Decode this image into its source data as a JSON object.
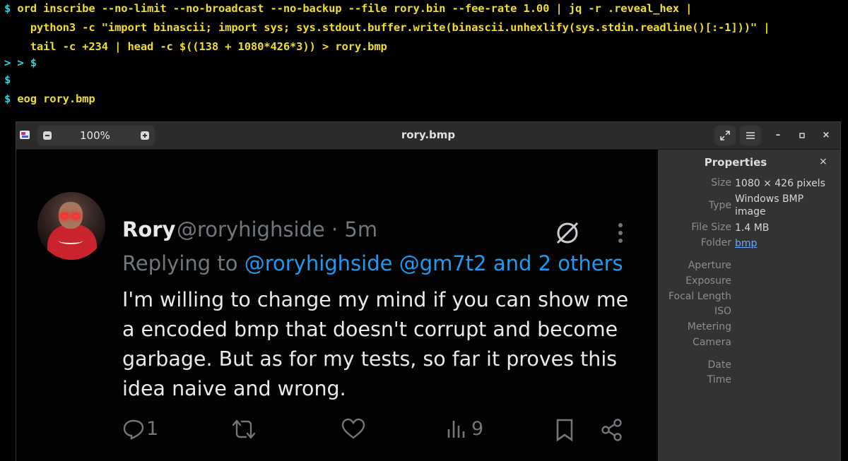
{
  "terminal": {
    "prompt_symbol": "$",
    "line1": " ord inscribe --no-limit --no-broadcast --no-backup --file rory.bin --fee-rate 1.00 | jq -r .reveal_hex |",
    "line2": "    python3 -c \"import binascii; import sys; sys.stdout.buffer.write(binascii.unhexlify(sys.stdin.readline()[:-1]))\" |",
    "line3": "    tail -c +234 | head -c $((138 + 1080*426*3)) > rory.bmp",
    "line4_prompt": "> > $",
    "line5_prompt": "$",
    "line6": " eog rory.bmp"
  },
  "viewer": {
    "title": "rory.bmp",
    "zoom": "100%",
    "zoom_chevron": "⌄",
    "minus": "−",
    "plus": "+",
    "fullscreen_icon": "⤢",
    "menu_icon": "☰",
    "minimize": "–",
    "maximize": "▫",
    "close": "×"
  },
  "tweet": {
    "name": "Rory",
    "handle_time": "@roryhighside · 5m",
    "replying_prefix": "Replying to ",
    "replying_to": "@roryhighside @gm7t2 and 2 others",
    "body": "I'm willing to change my mind if you can show me a encoded bmp that doesn't corrupt and become garbage. But as for my tests, so far it proves this idea naive and wrong.",
    "reply_count": "1",
    "views_count": "9"
  },
  "properties": {
    "title": "Properties",
    "close": "×",
    "rows": [
      {
        "key": "Size",
        "value": "1080 × 426 pixels"
      },
      {
        "key": "Type",
        "value": "Windows BMP image"
      },
      {
        "key": "File Size",
        "value": "1.4 MB"
      },
      {
        "key": "Folder",
        "value": "bmp"
      },
      {
        "key": "Aperture",
        "value": ""
      },
      {
        "key": "Exposure",
        "value": ""
      },
      {
        "key": "Focal Length",
        "value": ""
      },
      {
        "key": "ISO",
        "value": ""
      },
      {
        "key": "Metering",
        "value": ""
      },
      {
        "key": "Camera",
        "value": ""
      },
      {
        "key": "Date",
        "value": ""
      },
      {
        "key": "Time",
        "value": ""
      }
    ]
  },
  "colors": {
    "terminal_text": "#f0dd26",
    "prompt": "#2fd3d9",
    "tweet_link": "#1d9bf0",
    "muted": "#71767b"
  }
}
